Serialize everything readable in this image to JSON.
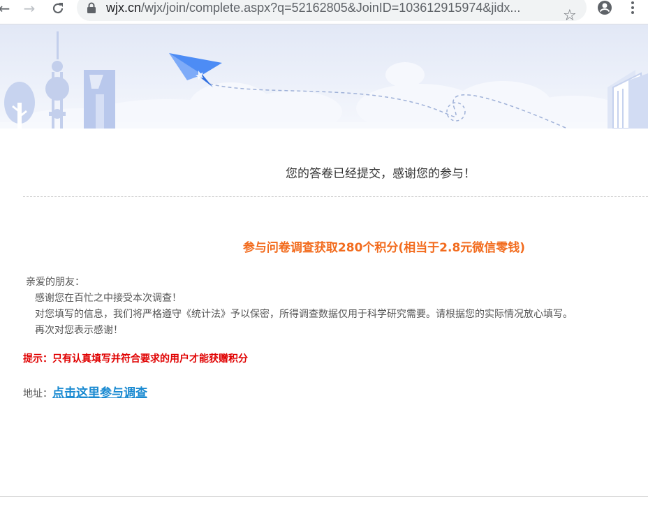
{
  "browser": {
    "url_host": "wjx.cn",
    "url_rest": "/wjx/join/complete.aspx?q=52162805&JoinID=103612915974&jidx...",
    "icons": [
      "back-icon",
      "forward-icon",
      "reload-icon",
      "lock-icon",
      "star-icon",
      "account-icon",
      "menu-icon"
    ]
  },
  "main": {
    "thanks_message": "您的答卷已经提交，感谢您的参与！",
    "promo_text": "参与问卷调查获取280个积分(相当于2.8元微信零钱)",
    "letter": {
      "greeting": "亲爱的朋友：",
      "line1": "感谢您在百忙之中接受本次调查！",
      "line2": "对您填写的信息，我们将严格遵守《统计法》予以保密，所得调查数据仅用于科学研究需要。请根据您的实际情况放心填写。",
      "line3": "再次对您表示感谢！"
    },
    "tip": "提示：只有认真填写并符合要求的用户才能获赠积分",
    "address_label": "地址：",
    "address_link": "点击这里参与调查"
  },
  "colors": {
    "promo": "#f26b1d",
    "tip": "#e00000",
    "link": "#1a8ad1",
    "banner": "#e2e8f6"
  }
}
